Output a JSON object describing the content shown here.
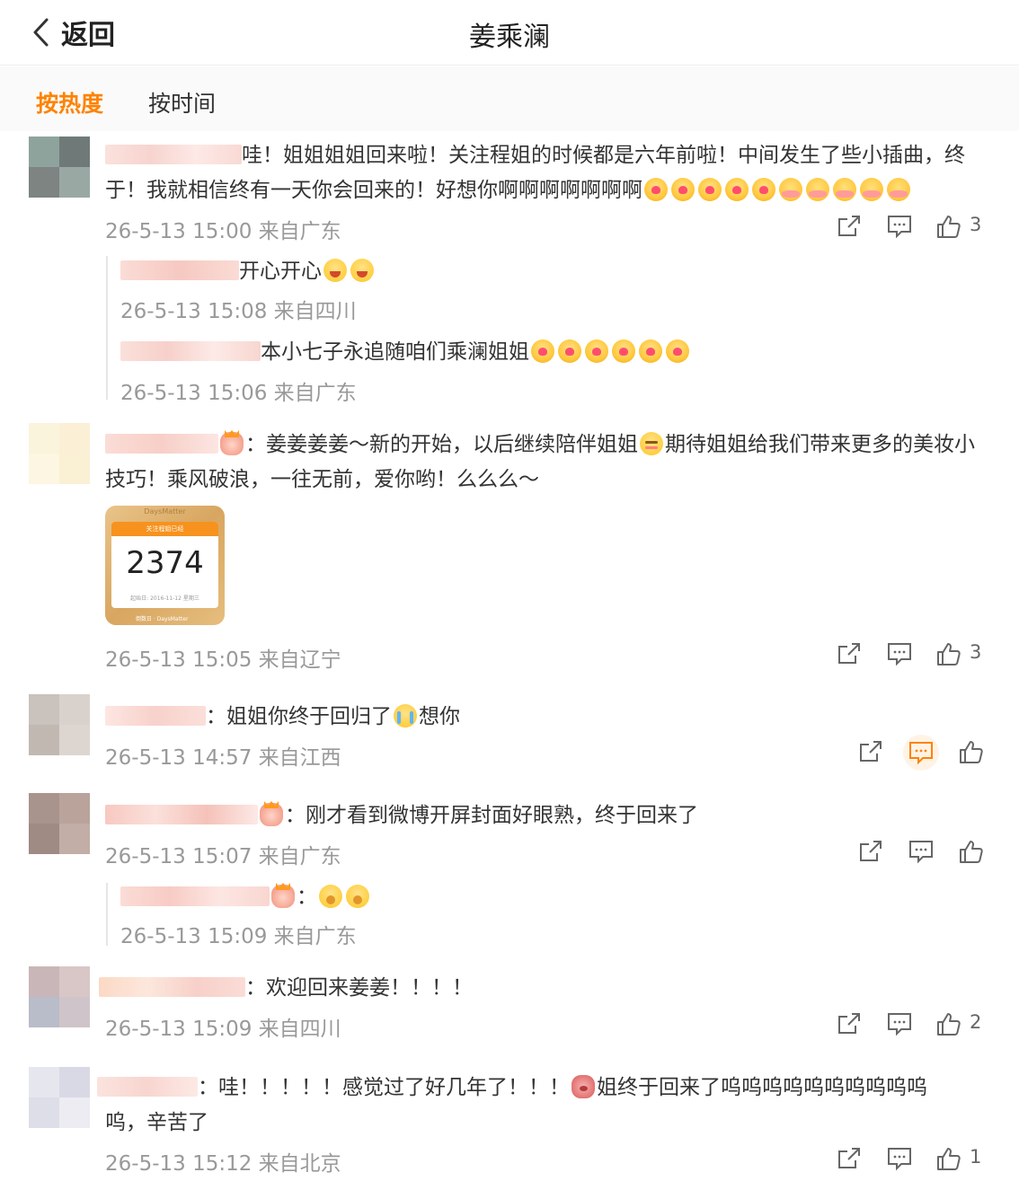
{
  "header": {
    "back_label": "返回",
    "title": "姜乘澜"
  },
  "sort_tabs": {
    "hot": "按热度",
    "time": "按时间"
  },
  "photo": {
    "app_name": "DaysMatter",
    "bar_label": "关注程姐已经",
    "number": "2374",
    "subtitle": "起始日: 2016-11-12 星期三",
    "footer": "倒数日 · DaysMatter"
  },
  "comments": [
    {
      "text_line1": "哇！姐姐姐姐回来啦！关注程姐的时候都是六年前啦！中间发生了些小插曲，终",
      "text_line2": "于！我就相信终有一天你会回来的！好想你啊啊啊啊啊啊啊",
      "meta": "26-5-13 15:00 来自广东",
      "likes": "3",
      "replies": [
        {
          "text": "开心开心",
          "meta": "26-5-13 15:08 来自四川"
        },
        {
          "text": "本小七子永追随咱们乘澜姐姐",
          "meta": "26-5-13 15:06 来自广东"
        }
      ]
    },
    {
      "text_line1": "：姜姜姜姜～新的开始，以后继续陪伴姐姐",
      "text_line1b": "期待姐姐给我们带来更多的美妆小",
      "text_line2": "技巧！乘风破浪，一往无前，爱你哟！么么么～",
      "meta": "26-5-13 15:05 来自辽宁",
      "likes": "3"
    },
    {
      "text": "：姐姐你终于回归了",
      "text_b": "想你",
      "meta": "26-5-13 14:57 来自江西"
    },
    {
      "text": "：刚才看到微博开屏封面好眼熟，终于回来了",
      "meta": "26-5-13 15:07 来自广东",
      "replies": [
        {
          "text": "：",
          "meta": "26-5-13 15:09 来自广东"
        }
      ]
    },
    {
      "text": "：欢迎回来姜姜！！！！",
      "meta": "26-5-13 15:09 来自四川",
      "likes": "2"
    },
    {
      "text_line1": "：哇！！！！！感觉过了好几年了！！！",
      "text_line1b": "姐终于回来了呜呜呜呜呜呜呜呜呜呜",
      "text_line2": "呜，辛苦了",
      "meta": "26-5-13 15:12 来自北京",
      "likes": "1"
    }
  ],
  "colors": {
    "accent": "#ff8200",
    "meta_text": "#999999",
    "body_text": "#333333"
  }
}
